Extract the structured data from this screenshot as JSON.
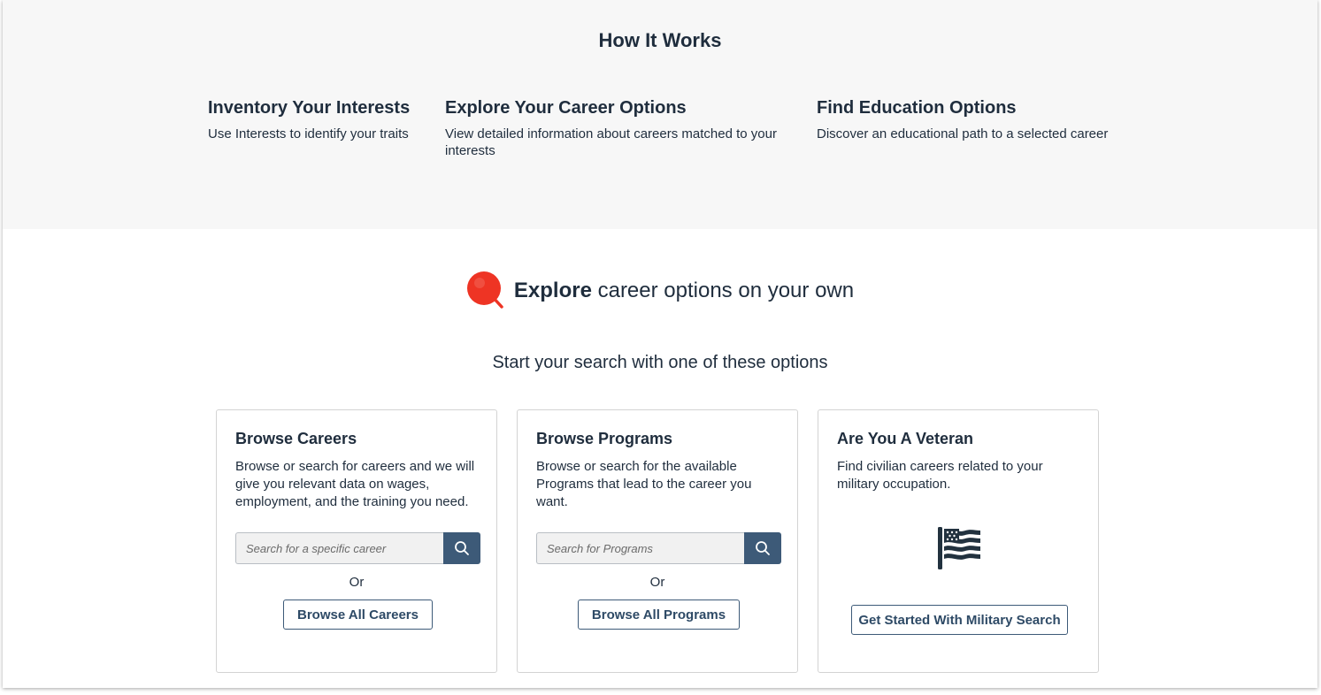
{
  "how_it_works": {
    "title": "How It Works",
    "steps": [
      {
        "title": "Inventory Your Interests",
        "desc": "Use Interests to identify your traits"
      },
      {
        "title": "Explore Your Career Options",
        "desc": "View detailed information about careers matched to your interests"
      },
      {
        "title": "Find Education Options",
        "desc": "Discover an educational path to a selected career"
      }
    ]
  },
  "explore": {
    "bold": "Explore",
    "rest": " career options on your own",
    "icon": "magnifier-icon"
  },
  "subhead": "Start your search with one of these options",
  "cards": [
    {
      "title": "Browse Careers",
      "desc": "Browse or search for careers and we will give you relevant data on wages, employment, and the training you need.",
      "search_placeholder": "Search for a specific career",
      "or": "Or",
      "button": "Browse All Careers"
    },
    {
      "title": "Browse Programs",
      "desc": "Browse or search for the available Programs that lead to the career you want.",
      "search_placeholder": "Search for Programs",
      "or": "Or",
      "button": "Browse All Programs"
    },
    {
      "title": "Are You A Veteran",
      "desc": "Find civilian careers related to your military occupation.",
      "icon": "flag-icon",
      "button": "Get Started With Military Search"
    }
  ],
  "colors": {
    "text": "#1f2d3d",
    "accent": "#3d5a78",
    "explore_icon": "#ee3424",
    "band_bg": "#f7f7f7"
  }
}
